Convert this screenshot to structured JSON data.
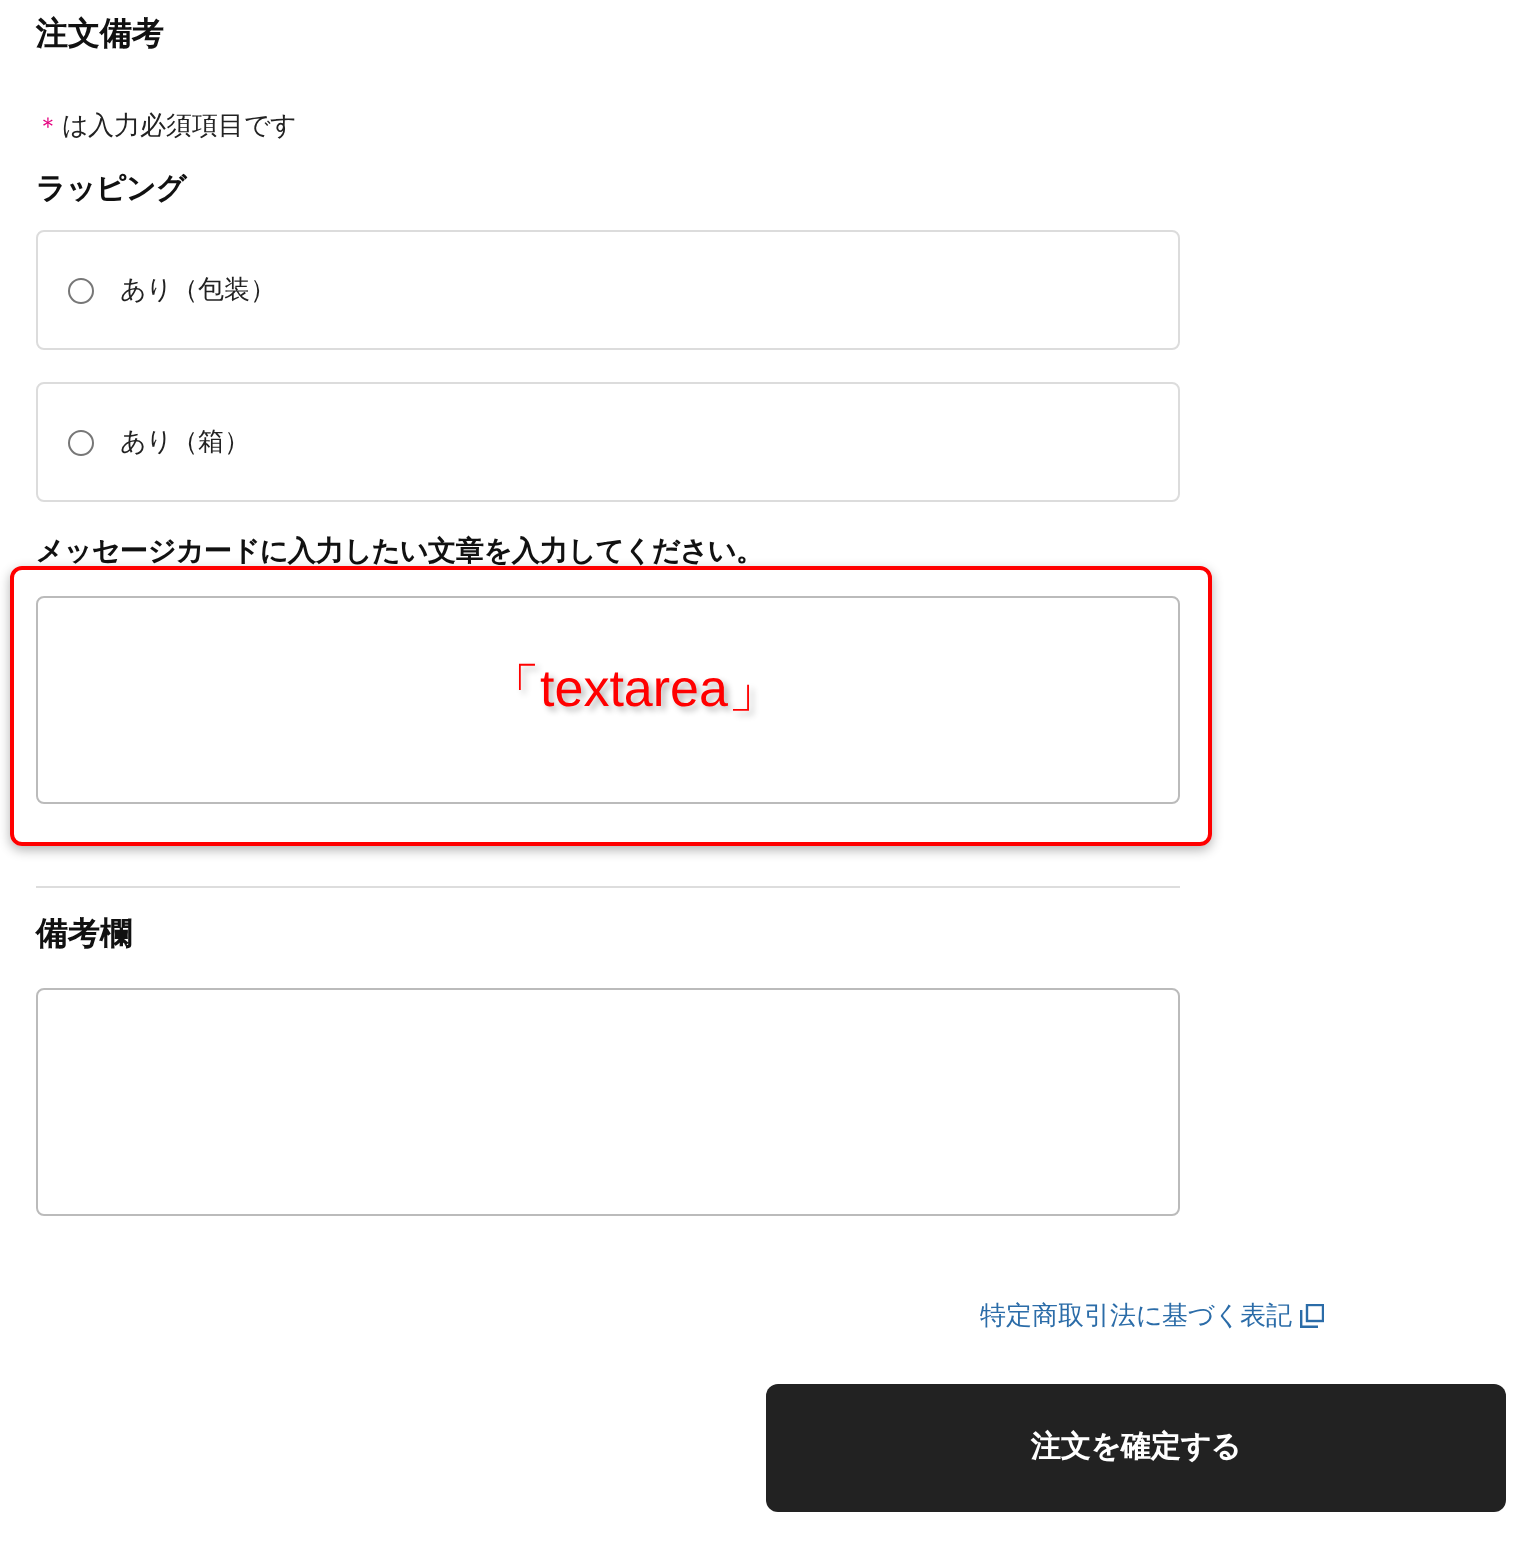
{
  "section": {
    "title": "注文備考"
  },
  "required_note": {
    "mark": "＊",
    "text": "は入力必須項目です"
  },
  "wrapping": {
    "label": "ラッピング",
    "options": [
      {
        "label": "あり（包装）",
        "selected": false
      },
      {
        "label": "あり（箱）",
        "selected": false
      }
    ]
  },
  "message_card": {
    "label": "メッセージカードに入力したい文章を入力してください。",
    "annotation": {
      "text": "「textarea」"
    }
  },
  "remarks": {
    "label": "備考欄"
  },
  "legal_link": {
    "text": "特定商取引法に基づく表記"
  },
  "submit_button": {
    "label": "注文を確定する"
  }
}
